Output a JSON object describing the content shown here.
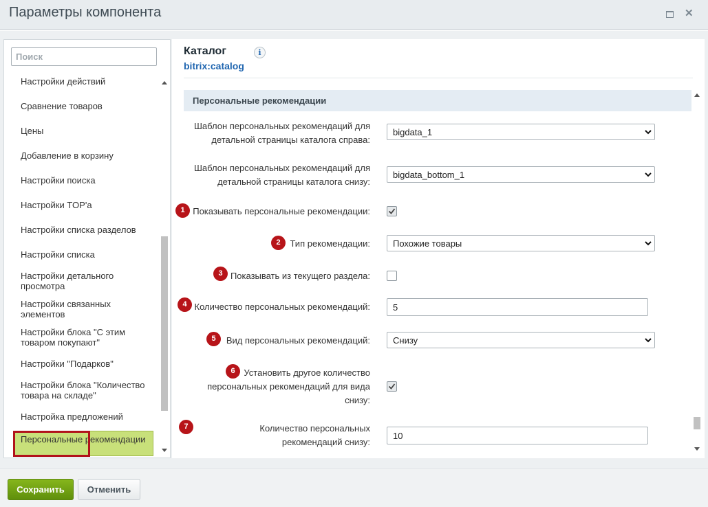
{
  "window": {
    "title": "Параметры компонента"
  },
  "sidebar": {
    "search_placeholder": "Поиск",
    "items": [
      "Настройки действий",
      "Сравнение товаров",
      "Цены",
      "Добавление в корзину",
      "Настройки поиска",
      "Настройки TOP'а",
      "Настройки списка разделов",
      "Настройки списка",
      "Настройки детального просмотра",
      "Настройки связанных элементов",
      "Настройки блока \"С этим товаром покупают\"",
      "Настройки \"Подарков\"",
      "Настройки блока \"Количество товара на складе\"",
      "Настройка предложений",
      "Персональные рекомендации"
    ],
    "active_index": 14
  },
  "component": {
    "title": "Каталог",
    "code": "bitrix:catalog",
    "info_icon": "i"
  },
  "section": {
    "title": "Персональные рекомендации",
    "fields": [
      {
        "label": "Шаблон персональных рекомендаций для детальной страницы каталога справа:",
        "type": "select",
        "value": "bigdata_1"
      },
      {
        "label": "Шаблон персональных рекомендаций для детальной страницы каталога снизу:",
        "type": "select",
        "value": "bigdata_bottom_1"
      },
      {
        "badge": "1",
        "label": "Показывать персональные рекомендации:",
        "type": "checkbox",
        "checked": true
      },
      {
        "badge": "2",
        "label": "Тип рекомендации:",
        "type": "select",
        "value": "Похожие товары"
      },
      {
        "badge": "3",
        "label": "Показывать из текущего раздела:",
        "type": "checkbox",
        "checked": false
      },
      {
        "badge": "4",
        "label": "Количество персональных рекомендаций:",
        "type": "text",
        "value": "5"
      },
      {
        "badge": "5",
        "label": "Вид персональных рекомендаций:",
        "type": "select",
        "value": "Снизу"
      },
      {
        "badge": "6",
        "label": "Установить другое количество персональных рекомендаций для вида снизу:",
        "type": "checkbox",
        "checked": true
      },
      {
        "badge": "7",
        "label": "Количество персональных рекомендаций снизу:",
        "type": "text",
        "value": "10"
      }
    ]
  },
  "footer": {
    "save_label": "Сохранить",
    "cancel_label": "Отменить"
  },
  "colors": {
    "accent_green": "#6c9c12",
    "active_item_bg": "#c8e07a",
    "badge_red": "#b71419",
    "link_blue": "#2066b0"
  }
}
